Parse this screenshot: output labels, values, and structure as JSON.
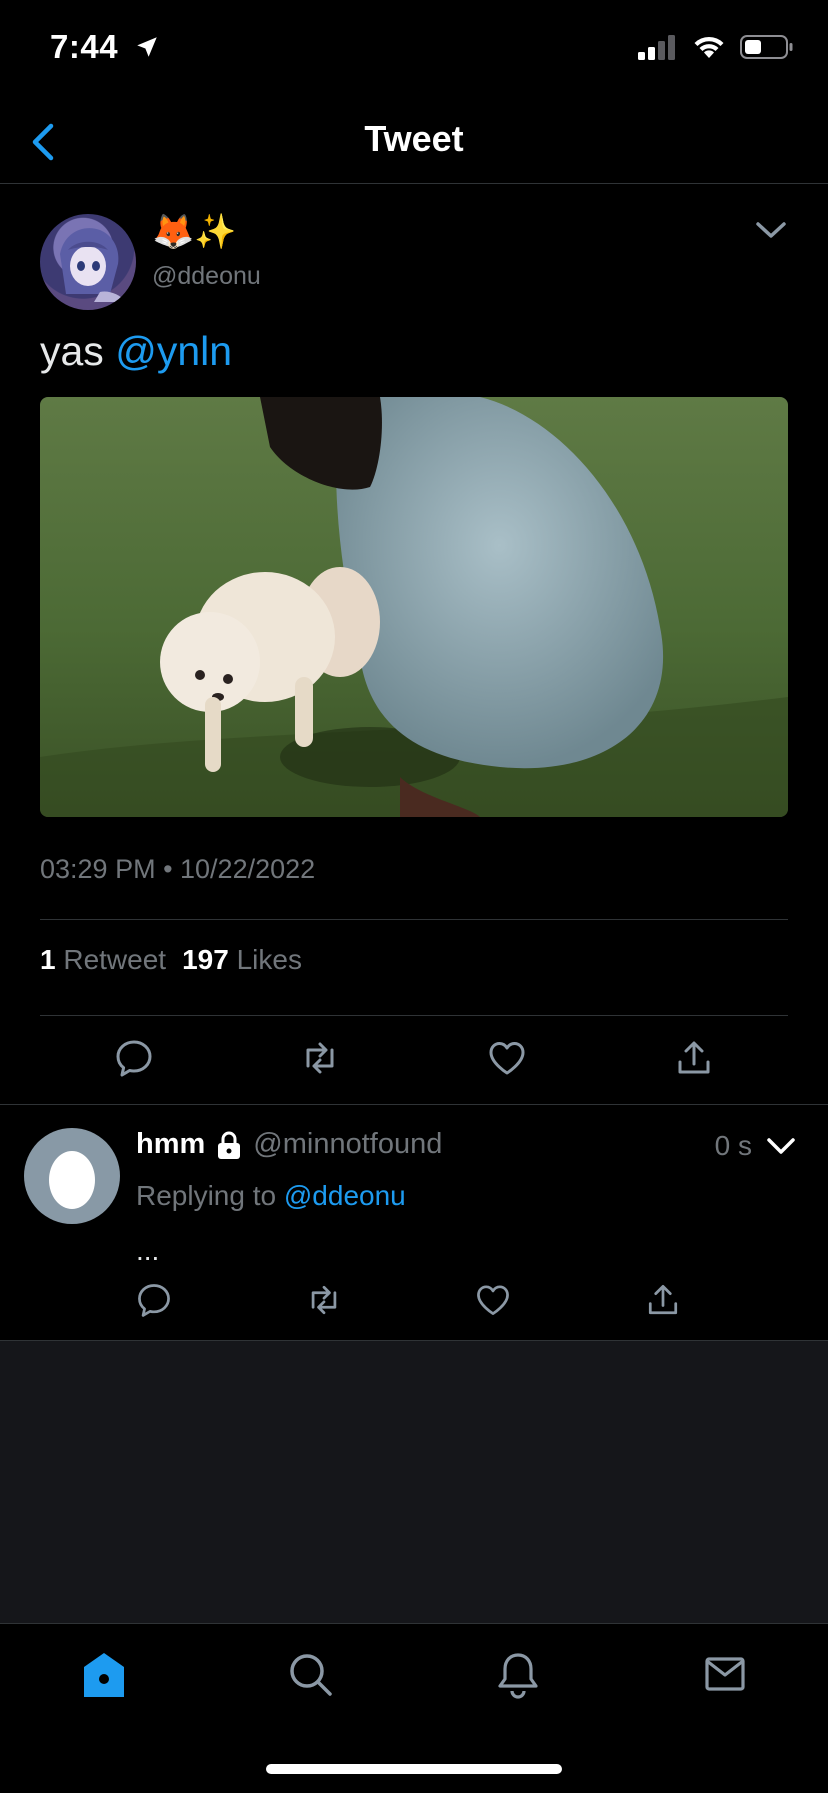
{
  "status_bar": {
    "time": "7:44"
  },
  "nav": {
    "title": "Tweet"
  },
  "tweet": {
    "display_name": "🦊✨",
    "handle": "@ddeonu",
    "text_prefix": "yas",
    "mention": "@ynln",
    "timestamp": "03:29 PM • 10/22/2022",
    "retweet_count": "1",
    "retweet_label": "Retweet",
    "like_count": "197",
    "like_label": "Likes"
  },
  "reply": {
    "name": "hmm",
    "handle": "@minnotfound",
    "time": "0 s",
    "replying_prefix": "Replying to",
    "replying_mention": "@ddeonu",
    "text": "..."
  },
  "icons": {
    "back": "chevron-left-icon",
    "reply": "comment-icon",
    "retweet": "retweet-icon",
    "like": "heart-icon",
    "share": "share-icon",
    "home": "home-icon",
    "search": "search-icon",
    "notifications": "bell-icon",
    "messages": "mail-icon"
  },
  "colors": {
    "accent": "#1d9bf0",
    "muted": "#71767b",
    "background": "#000000"
  }
}
